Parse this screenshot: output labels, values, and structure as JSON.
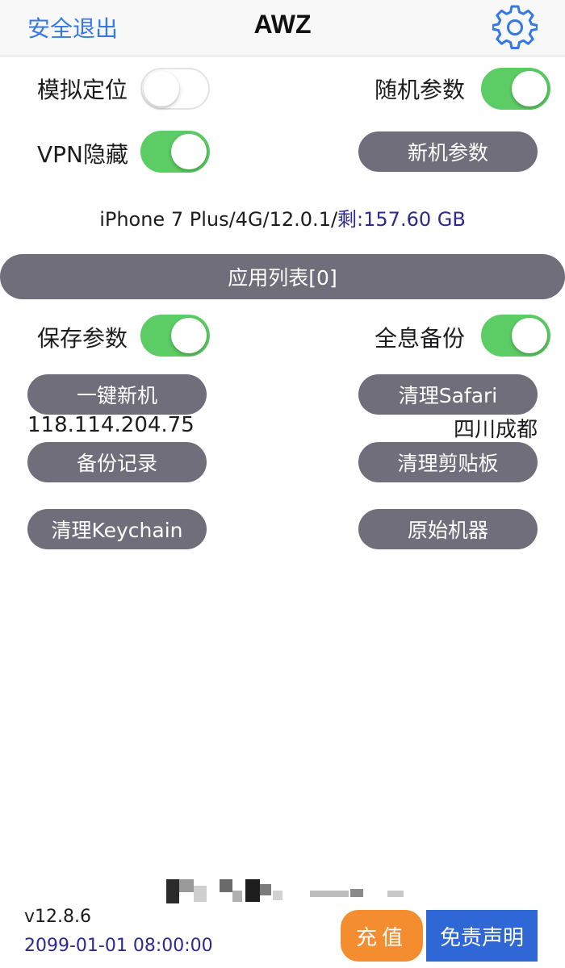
{
  "header": {
    "logout": "安全退出",
    "title": "AWZ",
    "settings_icon": "gear-icon",
    "accent": "#3578e5"
  },
  "toggles": {
    "mock_location": {
      "label": "模拟定位",
      "on": false
    },
    "random_params": {
      "label": "随机参数",
      "on": true
    },
    "vpn_hide": {
      "label": "VPN隐藏",
      "on": true
    },
    "save_params": {
      "label": "保存参数",
      "on": true
    },
    "full_backup": {
      "label": "全息备份",
      "on": true
    }
  },
  "buttons": {
    "new_device_params": "新机参数",
    "one_click_new": "一键新机",
    "clear_safari": "清理Safari",
    "backup_records": "备份记录",
    "clear_clipboard": "清理剪贴板",
    "clear_keychain": "清理Keychain",
    "original_device": "原始机器"
  },
  "device_info": {
    "text": "iPhone 7 Plus/4G/12.0.1/",
    "remaining_label": "剩:",
    "remaining_value": "157.60 GB"
  },
  "app_list": {
    "label": "应用列表[0]"
  },
  "network": {
    "ip": "118.114.204.75",
    "region": "四川成都"
  },
  "footer": {
    "version": "v12.8.6",
    "expiry": "2099-01-01 08:00:00",
    "recharge": "充值",
    "disclaimer": "免责声明"
  },
  "colors": {
    "toggle_on": "#5ccc64",
    "button_gray": "#6f6e7a",
    "recharge": "#f48d2f",
    "disclaimer": "#2f67d7"
  }
}
